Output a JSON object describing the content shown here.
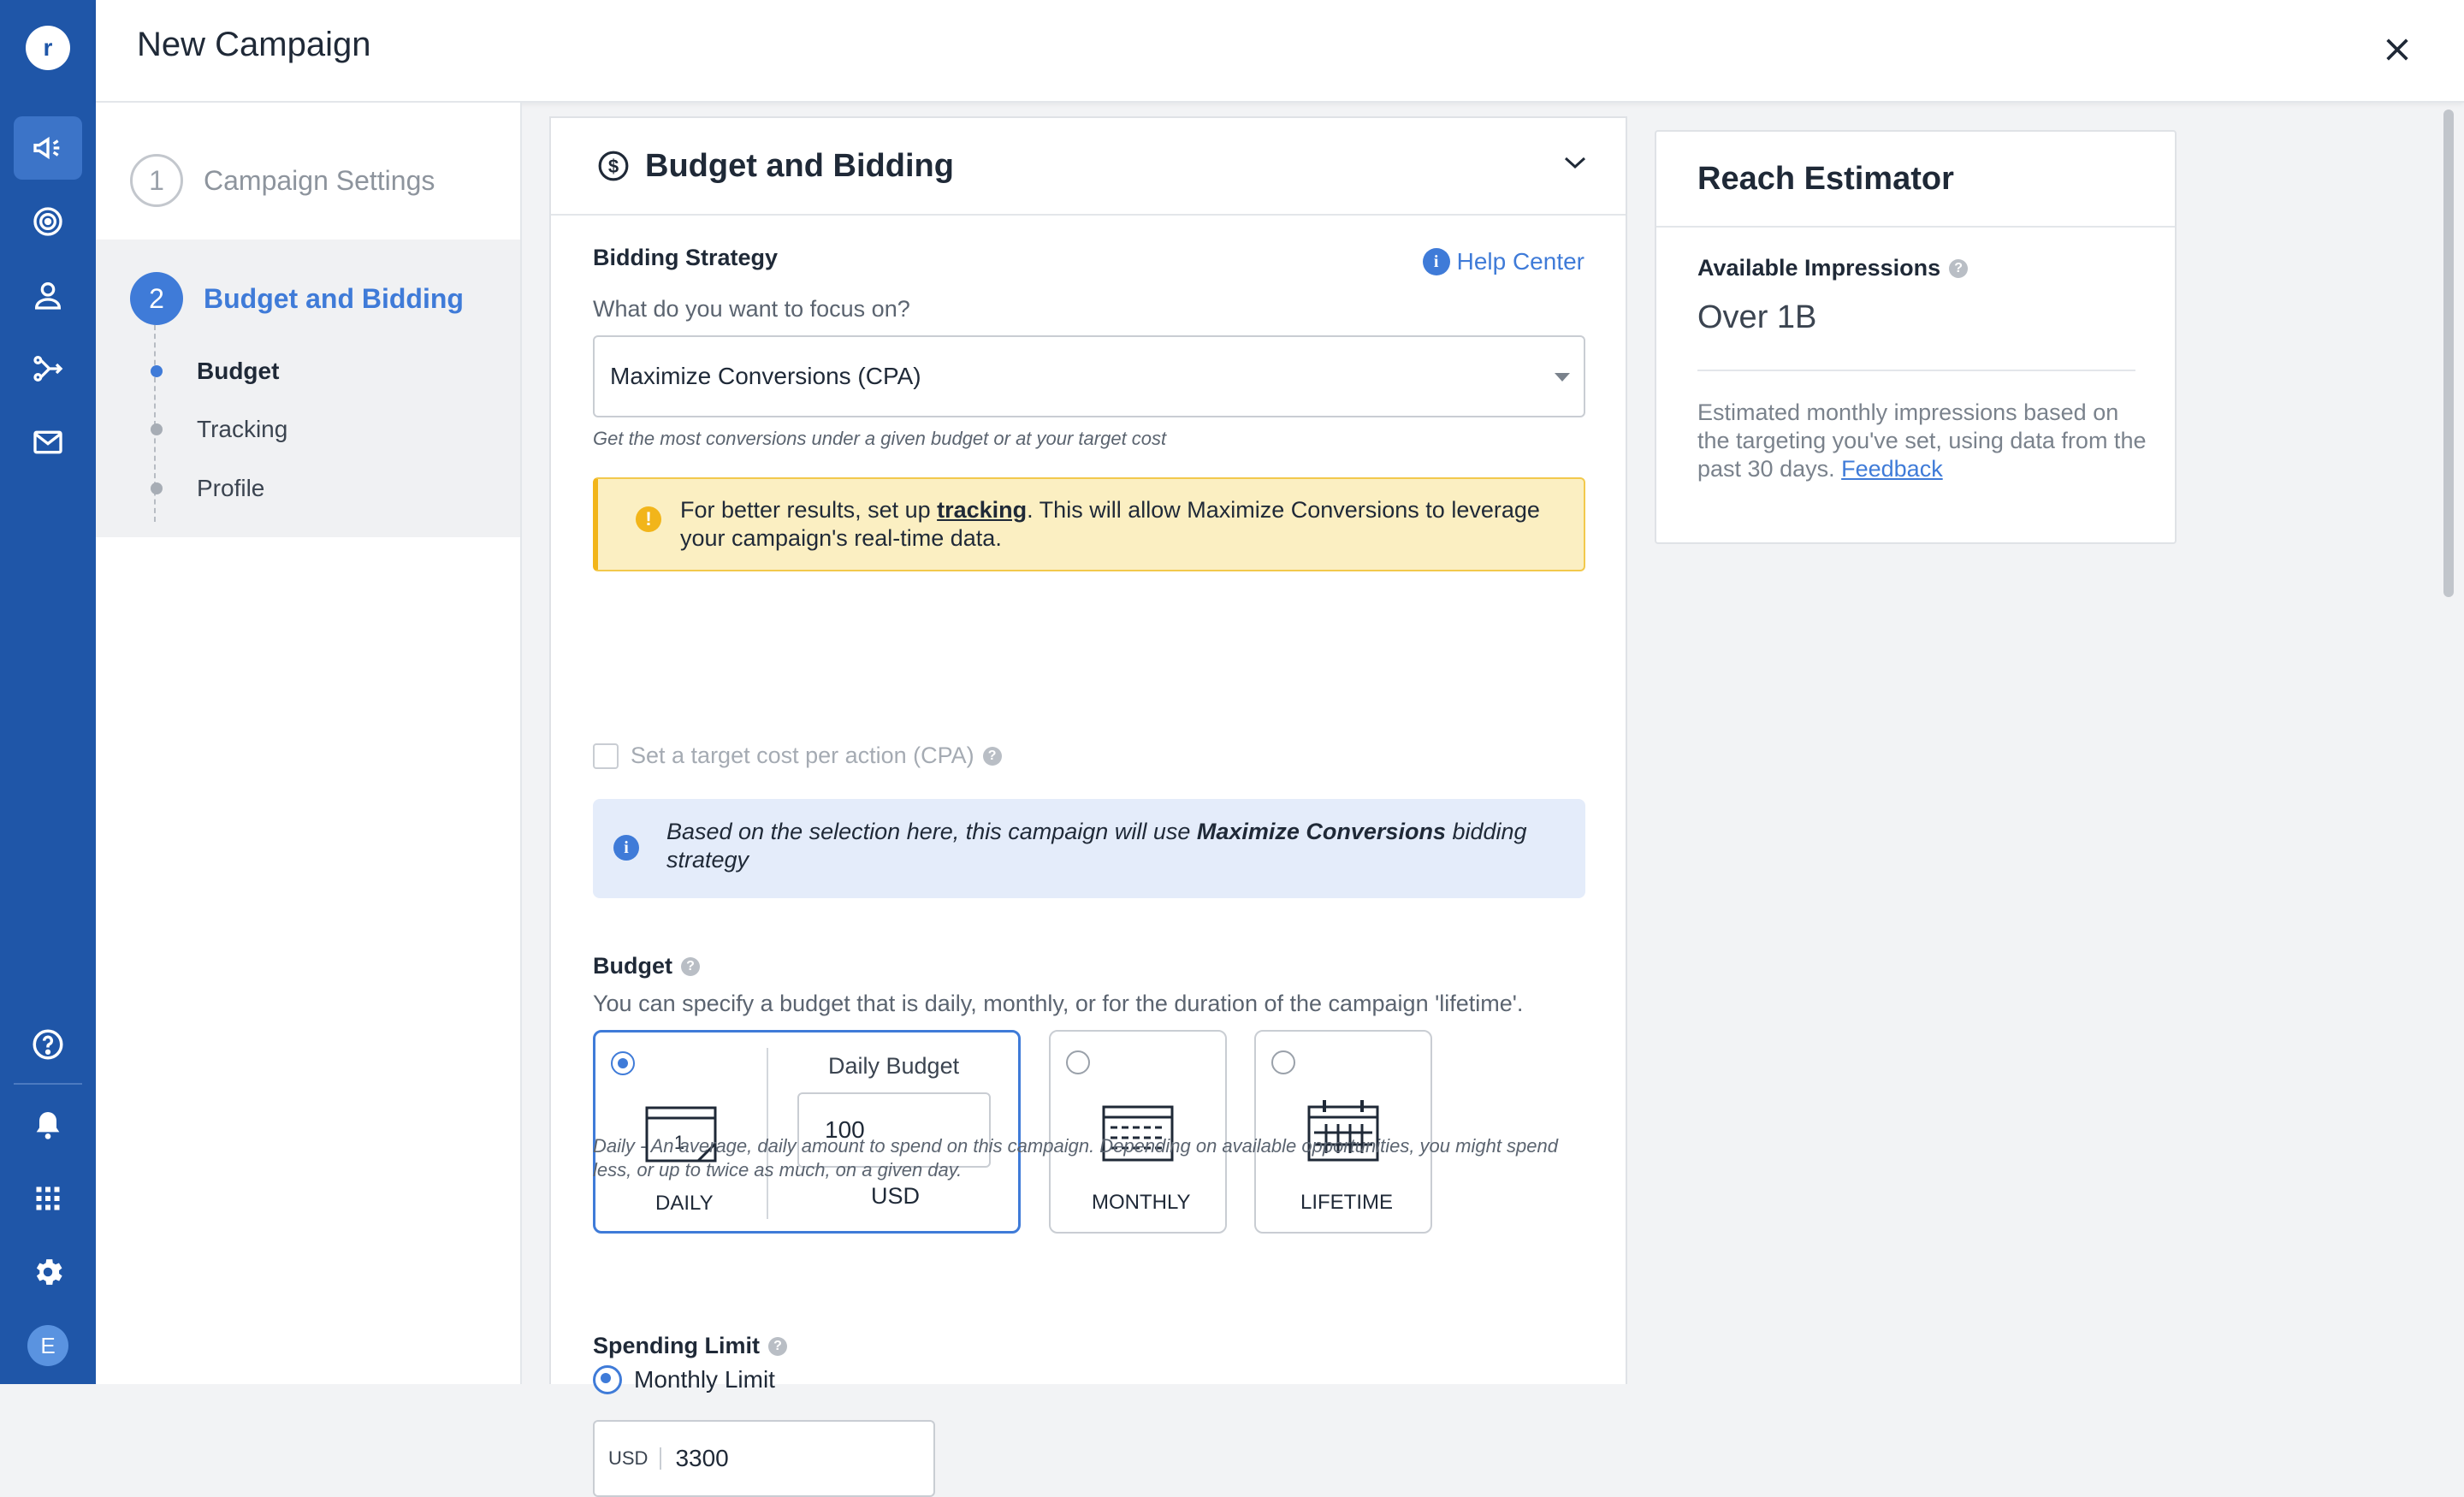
{
  "header": {
    "title": "New Campaign"
  },
  "rail": {
    "logo_letter": "r",
    "avatar_initial": "E",
    "items": [
      "campaigns-icon",
      "audiences-icon",
      "users-icon",
      "conversions-icon",
      "mail-icon"
    ],
    "bottom_items": [
      "help-icon",
      "bell-icon",
      "apps-grid-icon",
      "gear-icon"
    ],
    "accent": "#1f56a8"
  },
  "steps": {
    "step1": {
      "number": "1",
      "label": "Campaign Settings"
    },
    "step2": {
      "number": "2",
      "label": "Budget and Bidding"
    },
    "substeps": [
      "Budget",
      "Tracking",
      "Profile"
    ]
  },
  "budget_card": {
    "title": "Budget and Bidding",
    "bidding_label": "Bidding Strategy",
    "help_center": "Help Center",
    "focus_question": "What do you want to focus on?",
    "strategy_value": "Maximize Conversions (CPA)",
    "strategy_hint": "Get the most conversions under a given budget or at your target cost",
    "warning_pre": "For better results, set up ",
    "warning_link": "tracking",
    "warning_post": ". This will allow Maximize Conversions to leverage your campaign's real-time data.",
    "target_cost_label": "Set a target cost per action (CPA)",
    "info_pre": "Based on the selection here, this campaign will use ",
    "info_bold": "Maximize Conversions",
    "info_post": " bidding strategy",
    "budget_label": "Budget",
    "budget_desc": "You can specify a budget that is daily, monthly, or for the duration of the campaign 'lifetime'.",
    "options": {
      "daily": "DAILY",
      "monthly": "MONTHLY",
      "lifetime": "LIFETIME",
      "calendar_day": "1"
    },
    "daily_budget_label": "Daily Budget",
    "daily_budget_value": "100",
    "currency": "USD",
    "daily_note": "Daily - An average, daily amount to spend on this campaign. Depending on available opportunities, you might spend less, or up to twice as much, on a given day.",
    "spending_limit_label": "Spending Limit",
    "monthly_limit_label": "Monthly Limit",
    "limit_currency": "USD",
    "limit_value": "3300"
  },
  "reach": {
    "title": "Reach Estimator",
    "impressions_label": "Available Impressions",
    "impressions_value": "Over 1B",
    "note": "Estimated monthly impressions based on the targeting you've set, using data from the past 30 days.",
    "feedback": "Feedback"
  }
}
